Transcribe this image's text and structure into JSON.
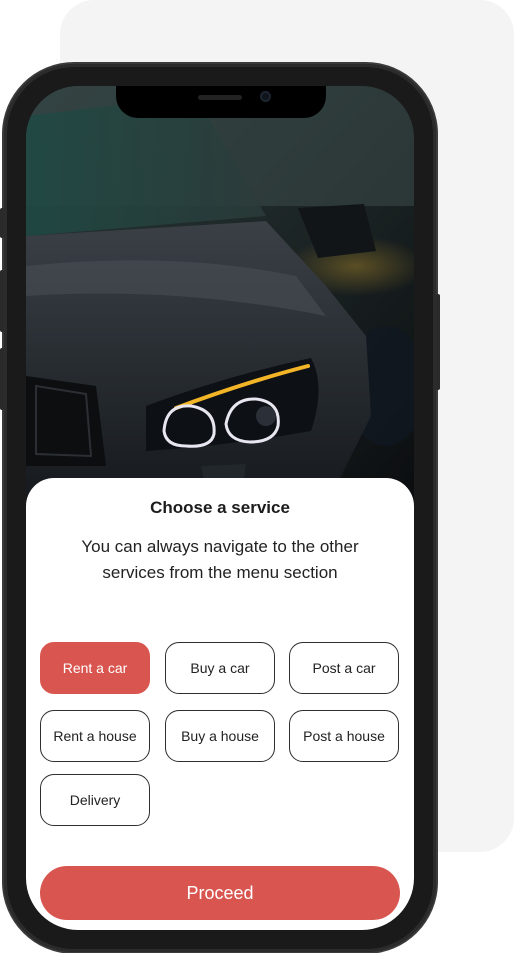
{
  "sheet": {
    "title": "Choose a service",
    "subtitle": "You can always navigate to the other services from the menu section"
  },
  "services": [
    {
      "label": "Rent a car",
      "selected": true
    },
    {
      "label": "Buy a car",
      "selected": false
    },
    {
      "label": "Post a car",
      "selected": false
    },
    {
      "label": "Rent a house",
      "selected": false
    },
    {
      "label": "Buy a house",
      "selected": false
    },
    {
      "label": "Post a house",
      "selected": false
    },
    {
      "label": "Delivery",
      "selected": false
    }
  ],
  "actions": {
    "proceed_label": "Proceed"
  },
  "colors": {
    "accent": "#d95650",
    "background_card": "#f4f4f4"
  },
  "hero_image": {
    "subject": "car-headlight-photo"
  }
}
